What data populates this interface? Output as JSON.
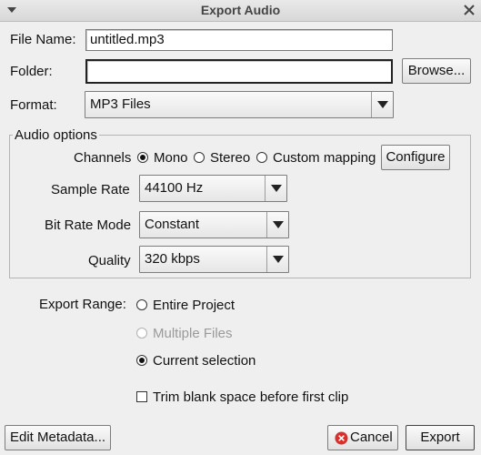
{
  "window": {
    "title": "Export Audio"
  },
  "file_name": {
    "label": "File Name:",
    "value": "untitled.mp3"
  },
  "folder": {
    "label": "Folder:",
    "value": "",
    "browse_label": "Browse..."
  },
  "format": {
    "label": "Format:",
    "value": "MP3 Files"
  },
  "audio_options": {
    "title": "Audio options",
    "channels": {
      "label": "Channels",
      "options": [
        "Mono",
        "Stereo",
        "Custom mapping"
      ],
      "selected": "Mono",
      "configure_label": "Configure"
    },
    "sample_rate": {
      "label": "Sample Rate",
      "value": "44100 Hz"
    },
    "bit_rate_mode": {
      "label": "Bit Rate Mode",
      "value": "Constant"
    },
    "quality": {
      "label": "Quality",
      "value": "320 kbps"
    }
  },
  "export_range": {
    "label": "Export Range:",
    "options": [
      "Entire Project",
      "Multiple Files",
      "Current selection"
    ],
    "selected": "Current selection",
    "disabled": "Multiple Files"
  },
  "trim": {
    "label": "Trim blank space before first clip",
    "checked": false
  },
  "buttons": {
    "edit_metadata": "Edit Metadata...",
    "cancel": "Cancel",
    "export": "Export"
  },
  "colors": {
    "cancel_icon": "#d9302c"
  }
}
